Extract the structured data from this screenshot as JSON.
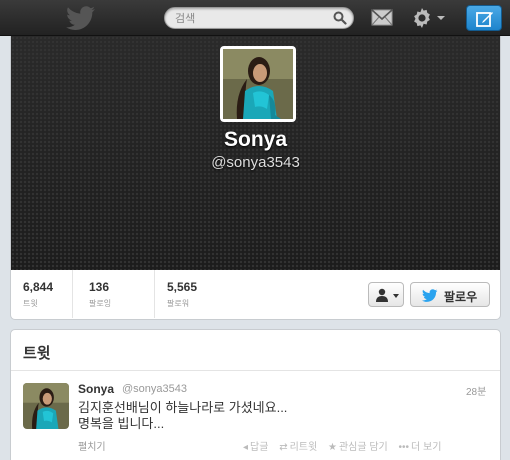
{
  "topbar": {
    "search_placeholder": "검색",
    "icons": [
      "twitter-bird-icon",
      "search-icon",
      "envelope-icon",
      "gear-icon",
      "compose-icon"
    ]
  },
  "profile": {
    "name": "Sonya",
    "handle": "@sonya3543",
    "stats": [
      {
        "value": "6,844",
        "label": "트윗"
      },
      {
        "value": "136",
        "label": "팔로잉"
      },
      {
        "value": "5,565",
        "label": "팔로워"
      }
    ],
    "follow_label": "팔로우"
  },
  "tweets": {
    "title": "트윗",
    "items": [
      {
        "name": "Sonya",
        "handle": "@sonya3543",
        "time": "28분",
        "line1": "김지훈선배님이 하늘나라로 가셨네요...",
        "line2": "명복을 빕니다...",
        "expand": "펼치기",
        "actions": {
          "reply": "답글",
          "retweet": "리트윗",
          "favorite": "관심글 담기",
          "more": "더 보기"
        }
      }
    ]
  },
  "colors": {
    "accent": "#1d84cc",
    "topbar": "#2b2b2b",
    "hero": "#252525"
  }
}
